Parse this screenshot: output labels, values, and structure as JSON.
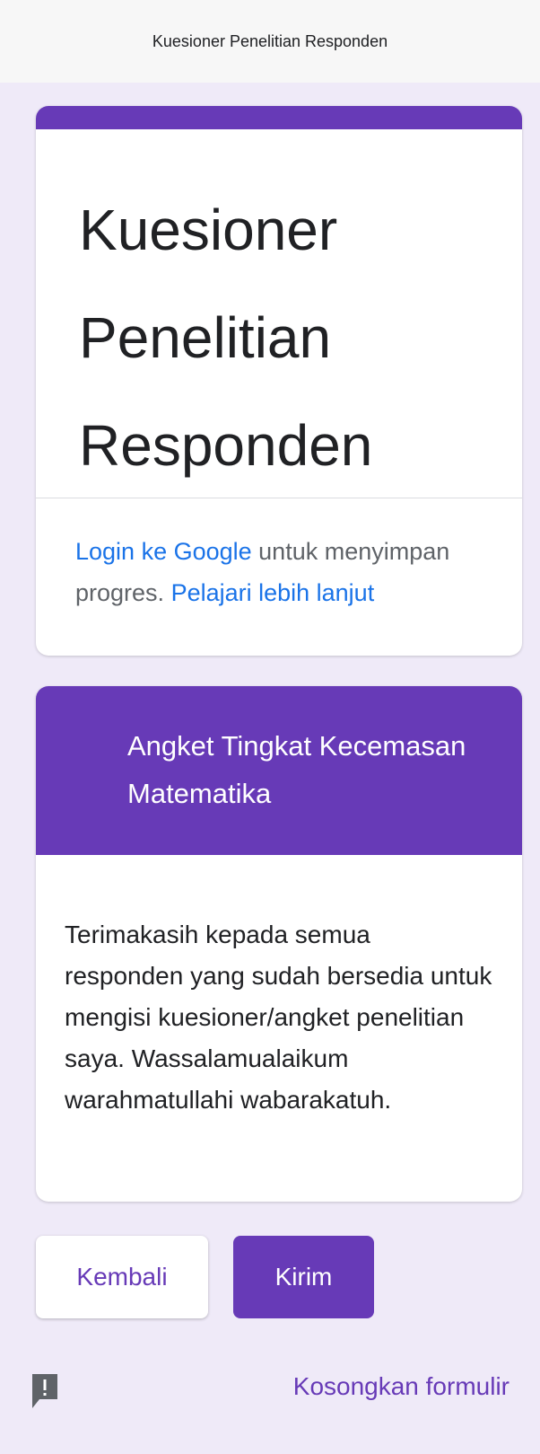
{
  "header": {
    "title": "Kuesioner Penelitian Responden"
  },
  "form": {
    "title": "Kuesioner Penelitian Responden",
    "login_link": "Login ke Google",
    "login_text": " untuk menyimpan progres. ",
    "learn_more": "Pelajari lebih lanjut"
  },
  "section": {
    "title": "Angket Tingkat Kecemasan Matematika",
    "description": "Terimakasih kepada semua responden yang sudah bersedia untuk mengisi kuesioner/angket penelitian saya. Wassalamualaikum warahmatullahi wabarakatuh."
  },
  "actions": {
    "back_label": "Kembali",
    "submit_label": "Kirim",
    "clear_label": "Kosongkan formulir"
  },
  "icons": {
    "report": "report-problem-icon"
  },
  "colors": {
    "accent": "#673ab7",
    "link": "#1a73e8",
    "background": "#efeaf8"
  }
}
